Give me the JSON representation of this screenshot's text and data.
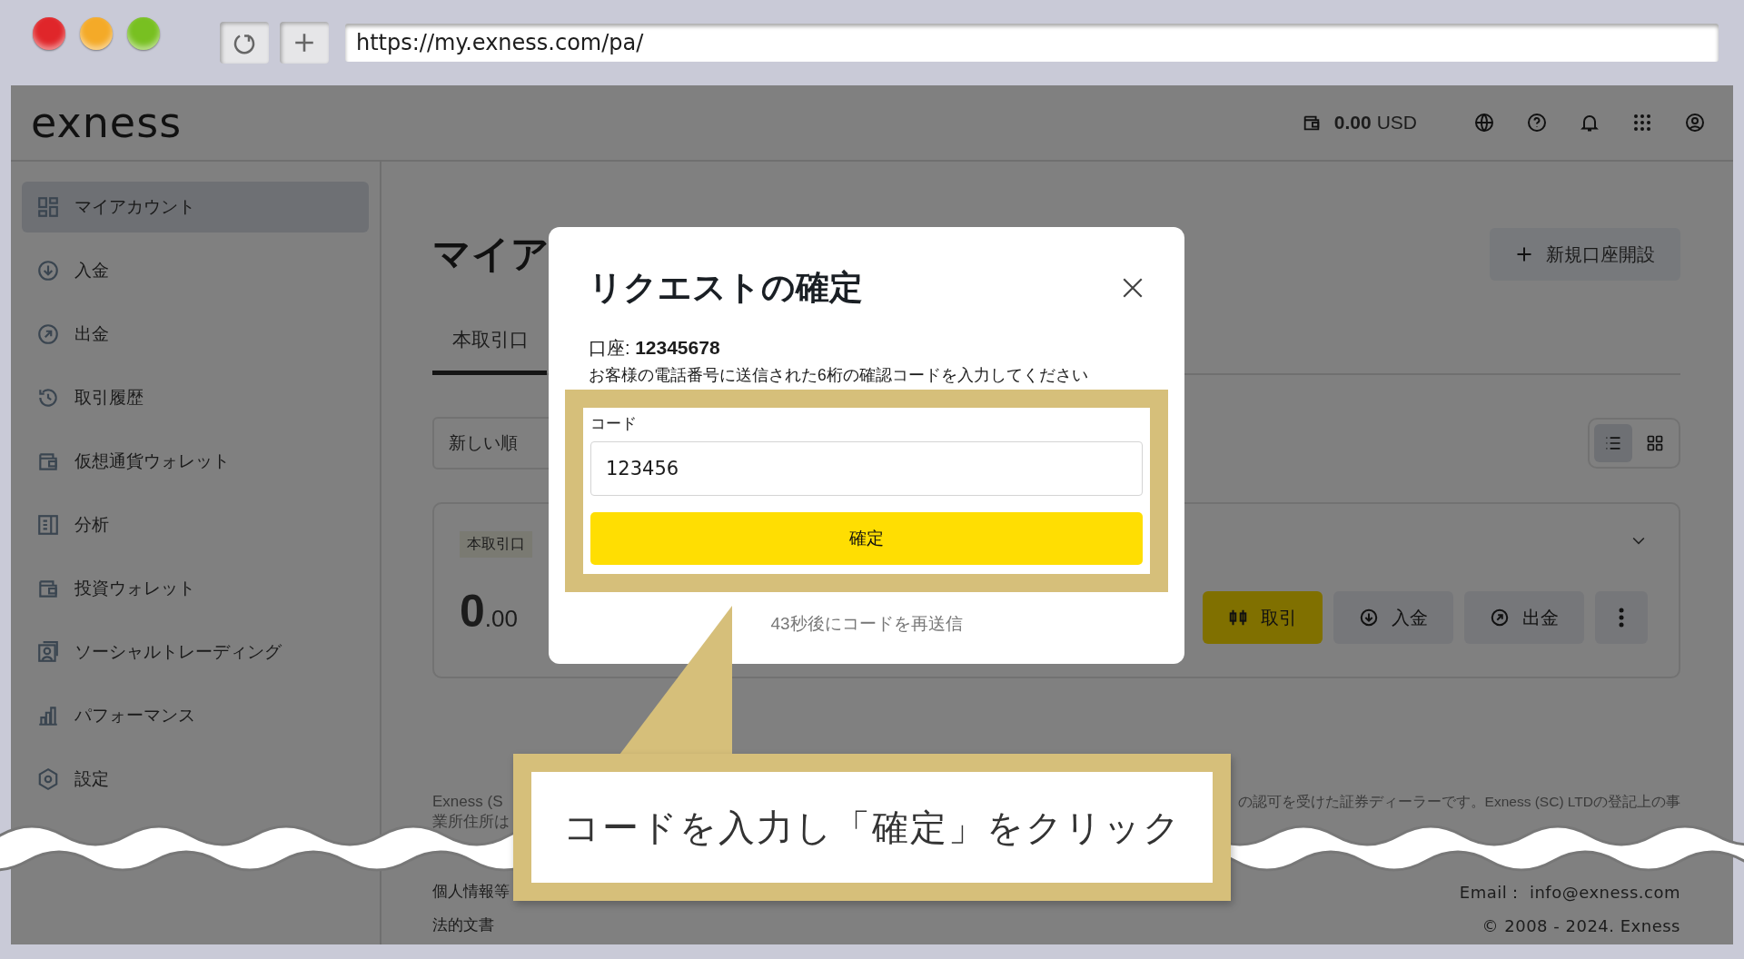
{
  "browser": {
    "url": "https://my.exness.com/pa/"
  },
  "header": {
    "logo": "exness",
    "balance_amount": "0.00",
    "balance_currency": "USD"
  },
  "sidebar": {
    "items": [
      {
        "label": "マイアカウント",
        "selected": true
      },
      {
        "label": "入金",
        "selected": false
      },
      {
        "label": "出金",
        "selected": false
      },
      {
        "label": "取引履歴",
        "selected": false
      },
      {
        "label": "仮想通貨ウォレット",
        "selected": false
      },
      {
        "label": "分析",
        "selected": false
      },
      {
        "label": "投資ウォレット",
        "selected": false
      },
      {
        "label": "ソーシャルトレーディング",
        "selected": false
      },
      {
        "label": "パフォーマンス",
        "selected": false
      },
      {
        "label": "設定",
        "selected": false
      }
    ]
  },
  "page": {
    "title": "マイア",
    "new_account_button": "新規口座開設",
    "tabs": [
      {
        "label": "本取引口",
        "selected": true
      }
    ],
    "sort": "新しい順",
    "view_options": [
      {
        "selected": true
      },
      {
        "selected": false
      }
    ]
  },
  "account_card": {
    "badge": "本取引口",
    "balance_whole": "0",
    "balance_fraction": ".00",
    "actions": [
      {
        "kind": "primary",
        "label": "取引"
      },
      {
        "kind": "secondary",
        "label": "入金"
      },
      {
        "kind": "secondary",
        "label": "出金"
      },
      {
        "kind": "more"
      }
    ]
  },
  "footer": {
    "disclaimer_left": [
      "Exness (S",
      "業所住所は"
    ],
    "disclaimer_right": "の認可を受けた証券ディーラーです。Exness (SC) LTDの登記上の事",
    "links": [
      "個人情報等",
      "法的文書"
    ],
    "email": "Email： info@exness.com",
    "copyright": "© 2008 - 2024. Exness"
  },
  "dialog": {
    "title": "リクエストの確定",
    "account": "口座: **12345678**",
    "instruction": "お客様の電話番号に送信された6桁の確認コードを入力してください",
    "code_label": "コード",
    "code_value": "123456",
    "confirm_button": "確定",
    "resend": "43秒後にコードを再送信"
  },
  "callout": {
    "text": "コードを入力し「確定」をクリック"
  }
}
